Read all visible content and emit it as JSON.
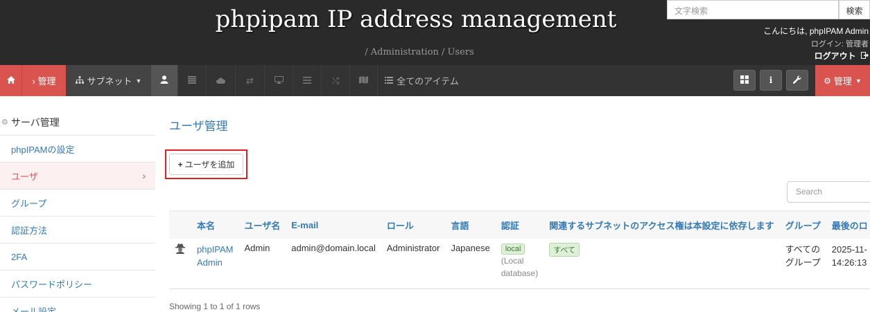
{
  "header": {
    "brand": "phpipam IP address management",
    "breadcrumb": "/ Administration / Users",
    "search_placeholder": "文字検索",
    "search_button": "検索",
    "greeting": "こんにちは, phpIPAM Admin",
    "login_role": "ログイン: 管理者",
    "logout": "ログアウト"
  },
  "navbar": {
    "admin_crumb": "› 管理",
    "subnets": "サブネット",
    "all_items": "全てのアイテム",
    "admin_menu": "管理"
  },
  "sidebar": {
    "title": "サーバ管理",
    "items": [
      {
        "label": "phpIPAMの設定"
      },
      {
        "label": "ユーザ"
      },
      {
        "label": "グループ"
      },
      {
        "label": "認証方法"
      },
      {
        "label": "2FA"
      },
      {
        "label": "パスワードポリシー"
      },
      {
        "label": "メール設定"
      }
    ]
  },
  "main": {
    "title": "ユーザ管理",
    "add_user": "ユーザを追加",
    "search_placeholder": "Search",
    "columns": [
      "本名",
      "ユーザ名",
      "E-mail",
      "ロール",
      "言語",
      "認証",
      "関連するサブネットのアクセス権は本設定に依存します",
      "グループ",
      "最後のロ"
    ],
    "rows": [
      {
        "real_name_1": "phpIPAM",
        "real_name_2": "Admin",
        "username": "Admin",
        "email": "admin@domain.local",
        "role": "Administrator",
        "language": "Japanese",
        "auth_badge": "local",
        "auth_detail_1": "(Local",
        "auth_detail_2": "database)",
        "subnet_perm": "すべて",
        "group_1": "すべての",
        "group_2": "グループ",
        "last_login_1": "2025-11-",
        "last_login_2": "14:26:13"
      }
    ],
    "footer": "Showing 1 to 1 of 1 rows"
  },
  "colors": {
    "header_bg": "#2a2a2a",
    "nav_bg": "#333333",
    "accent_red": "#d9534f",
    "link_blue": "#337ab7",
    "highlight_red": "#e02020"
  }
}
